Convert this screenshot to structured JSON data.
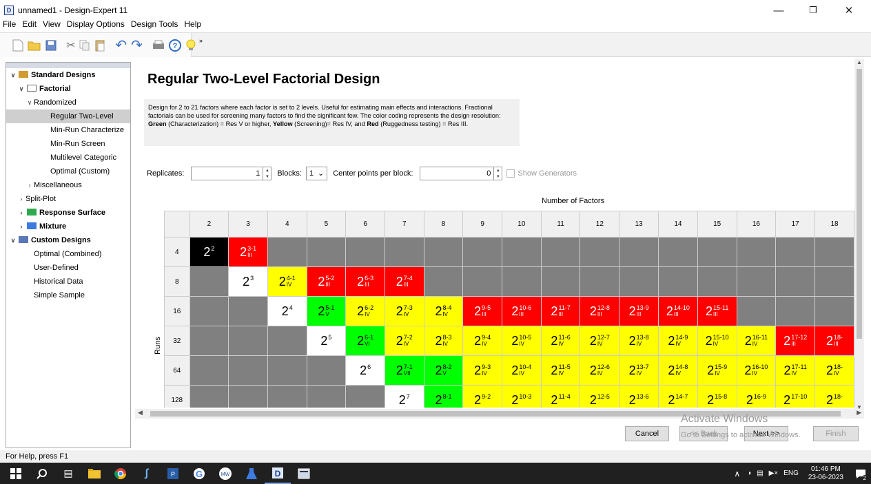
{
  "window": {
    "title": "unnamed1 - Design-Expert 11",
    "app_icon": "D"
  },
  "menu": [
    "File",
    "Edit",
    "View",
    "Display Options",
    "Design Tools",
    "Help"
  ],
  "toolbar": [
    "new-icon",
    "open-icon",
    "save-icon",
    "cut-icon",
    "copy-icon",
    "paste-icon",
    "undo-icon",
    "redo-icon",
    "print-icon",
    "help-icon",
    "tip-icon"
  ],
  "tree": [
    {
      "label": "Standard Designs",
      "bold": true,
      "chev": "v",
      "indent": 0
    },
    {
      "label": "Factorial",
      "bold": true,
      "chev": "v",
      "indent": 1
    },
    {
      "label": "Randomized",
      "chev": "v",
      "indent": 2
    },
    {
      "label": "Regular Two-Level",
      "indent": 4,
      "selected": true
    },
    {
      "label": "Min-Run Characterize",
      "indent": 4
    },
    {
      "label": "Min-Run Screen",
      "indent": 4
    },
    {
      "label": "Multilevel Categoric",
      "indent": 4
    },
    {
      "label": "Optimal (Custom)",
      "indent": 4
    },
    {
      "label": "Miscellaneous",
      "chev": ">",
      "indent": 2
    },
    {
      "label": "Split-Plot",
      "chev": ">",
      "indent": 1
    },
    {
      "label": "Response Surface",
      "bold": true,
      "chev": ">",
      "indent": 1
    },
    {
      "label": "Mixture",
      "bold": true,
      "chev": ">",
      "indent": 1
    },
    {
      "label": "Custom Designs",
      "bold": true,
      "chev": "v",
      "indent": 0
    },
    {
      "label": "Optimal (Combined)",
      "indent": 2
    },
    {
      "label": "User-Defined",
      "indent": 2
    },
    {
      "label": "Historical Data",
      "indent": 2
    },
    {
      "label": "Simple Sample",
      "indent": 2
    }
  ],
  "main": {
    "title": "Regular Two-Level Factorial Design",
    "desc_1": "Design for 2 to 21 factors where each factor is set to 2 levels. Useful for estimating main effects and interactions. Fractional factorials can be used for screening many factors to find the significant few. The color coding represents the design resolution: ",
    "desc_green": "Green",
    "desc_2": " (Characterization) = Res V or higher, ",
    "desc_yellow": "Yellow",
    "desc_3": " (Screening)= Res IV, and ",
    "desc_red": "Red",
    "desc_4": " (Ruggedness testing) = Res III.",
    "replicates_label": "Replicates:",
    "replicates_value": "1",
    "blocks_label": "Blocks:",
    "blocks_value": "1",
    "center_label": "Center points per block:",
    "center_value": "0",
    "show_generators": "Show Generators",
    "factors_label": "Number of Factors",
    "runs_label": "Runs"
  },
  "grid": {
    "factors": [
      "2",
      "3",
      "4",
      "5",
      "6",
      "7",
      "8",
      "9",
      "10",
      "11",
      "12",
      "13",
      "14",
      "15",
      "16",
      "17",
      "18"
    ],
    "rows": [
      {
        "runs": "4",
        "cells": [
          {
            "c": "blk",
            "e": "2"
          },
          {
            "c": "red",
            "e": "3-1",
            "r": "III"
          },
          {
            "c": "gray"
          },
          {
            "c": "gray"
          },
          {
            "c": "gray"
          },
          {
            "c": "gray"
          },
          {
            "c": "gray"
          },
          {
            "c": "gray"
          },
          {
            "c": "gray"
          },
          {
            "c": "gray"
          },
          {
            "c": "gray"
          },
          {
            "c": "gray"
          },
          {
            "c": "gray"
          },
          {
            "c": "gray"
          },
          {
            "c": "gray"
          },
          {
            "c": "gray"
          },
          {
            "c": "gray"
          }
        ]
      },
      {
        "runs": "8",
        "cells": [
          {
            "c": "gray"
          },
          {
            "c": "wht",
            "e": "3"
          },
          {
            "c": "yel",
            "e": "4-1",
            "r": "IV"
          },
          {
            "c": "red",
            "e": "5-2",
            "r": "III"
          },
          {
            "c": "red",
            "e": "6-3",
            "r": "III"
          },
          {
            "c": "red",
            "e": "7-4",
            "r": "III"
          },
          {
            "c": "gray"
          },
          {
            "c": "gray"
          },
          {
            "c": "gray"
          },
          {
            "c": "gray"
          },
          {
            "c": "gray"
          },
          {
            "c": "gray"
          },
          {
            "c": "gray"
          },
          {
            "c": "gray"
          },
          {
            "c": "gray"
          },
          {
            "c": "gray"
          },
          {
            "c": "gray"
          }
        ]
      },
      {
        "runs": "16",
        "cells": [
          {
            "c": "gray"
          },
          {
            "c": "gray"
          },
          {
            "c": "wht",
            "e": "4"
          },
          {
            "c": "grn",
            "e": "5-1",
            "r": "V"
          },
          {
            "c": "yel",
            "e": "6-2",
            "r": "IV"
          },
          {
            "c": "yel",
            "e": "7-3",
            "r": "IV"
          },
          {
            "c": "yel",
            "e": "8-4",
            "r": "IV"
          },
          {
            "c": "red",
            "e": "9-5",
            "r": "III"
          },
          {
            "c": "red",
            "e": "10-6",
            "r": "III"
          },
          {
            "c": "red",
            "e": "11-7",
            "r": "III"
          },
          {
            "c": "red",
            "e": "12-8",
            "r": "III"
          },
          {
            "c": "red",
            "e": "13-9",
            "r": "III"
          },
          {
            "c": "red",
            "e": "14-10",
            "r": "III"
          },
          {
            "c": "red",
            "e": "15-11",
            "r": "III"
          },
          {
            "c": "gray"
          },
          {
            "c": "gray"
          },
          {
            "c": "gray"
          }
        ]
      },
      {
        "runs": "32",
        "cells": [
          {
            "c": "gray"
          },
          {
            "c": "gray"
          },
          {
            "c": "gray"
          },
          {
            "c": "wht",
            "e": "5"
          },
          {
            "c": "grn",
            "e": "6-1",
            "r": "VI"
          },
          {
            "c": "yel",
            "e": "7-2",
            "r": "IV"
          },
          {
            "c": "yel",
            "e": "8-3",
            "r": "IV"
          },
          {
            "c": "yel",
            "e": "9-4",
            "r": "IV"
          },
          {
            "c": "yel",
            "e": "10-5",
            "r": "IV"
          },
          {
            "c": "yel",
            "e": "11-6",
            "r": "IV"
          },
          {
            "c": "yel",
            "e": "12-7",
            "r": "IV"
          },
          {
            "c": "yel",
            "e": "13-8",
            "r": "IV"
          },
          {
            "c": "yel",
            "e": "14-9",
            "r": "IV"
          },
          {
            "c": "yel",
            "e": "15-10",
            "r": "IV"
          },
          {
            "c": "yel",
            "e": "16-11",
            "r": "IV"
          },
          {
            "c": "red",
            "e": "17-12",
            "r": "III"
          },
          {
            "c": "red",
            "e": "18-",
            "r": "III"
          }
        ]
      },
      {
        "runs": "64",
        "cells": [
          {
            "c": "gray"
          },
          {
            "c": "gray"
          },
          {
            "c": "gray"
          },
          {
            "c": "gray"
          },
          {
            "c": "wht",
            "e": "6"
          },
          {
            "c": "grn",
            "e": "7-1",
            "r": "VII"
          },
          {
            "c": "grn",
            "e": "8-2",
            "r": "V"
          },
          {
            "c": "yel",
            "e": "9-3",
            "r": "IV"
          },
          {
            "c": "yel",
            "e": "10-4",
            "r": "IV"
          },
          {
            "c": "yel",
            "e": "11-5",
            "r": "IV"
          },
          {
            "c": "yel",
            "e": "12-6",
            "r": "IV"
          },
          {
            "c": "yel",
            "e": "13-7",
            "r": "IV"
          },
          {
            "c": "yel",
            "e": "14-8",
            "r": "IV"
          },
          {
            "c": "yel",
            "e": "15-9",
            "r": "IV"
          },
          {
            "c": "yel",
            "e": "16-10",
            "r": "IV"
          },
          {
            "c": "yel",
            "e": "17-11",
            "r": "IV"
          },
          {
            "c": "yel",
            "e": "18-",
            "r": "IV"
          }
        ]
      },
      {
        "runs": "128",
        "cells": [
          {
            "c": "gray"
          },
          {
            "c": "gray"
          },
          {
            "c": "gray"
          },
          {
            "c": "gray"
          },
          {
            "c": "gray"
          },
          {
            "c": "wht",
            "e": "7"
          },
          {
            "c": "grn",
            "e": "8-1"
          },
          {
            "c": "yel",
            "e": "9-2"
          },
          {
            "c": "yel",
            "e": "10-3"
          },
          {
            "c": "yel",
            "e": "11-4"
          },
          {
            "c": "yel",
            "e": "12-5"
          },
          {
            "c": "yel",
            "e": "13-6"
          },
          {
            "c": "yel",
            "e": "14-7"
          },
          {
            "c": "yel",
            "e": "15-8"
          },
          {
            "c": "yel",
            "e": "16-9"
          },
          {
            "c": "yel",
            "e": "17-10"
          },
          {
            "c": "yel",
            "e": "18-"
          }
        ]
      }
    ]
  },
  "buttons": {
    "cancel": "Cancel",
    "back": "<< Back",
    "next": "Next >>",
    "finish": "Finish"
  },
  "watermark": {
    "line1": "Activate Windows",
    "line2": "Go to Settings to activate Windows."
  },
  "status": "For Help, press F1",
  "taskbar": {
    "lang": "ENG",
    "time": "01:46 PM",
    "date": "23-06-2023",
    "notif": "2"
  }
}
